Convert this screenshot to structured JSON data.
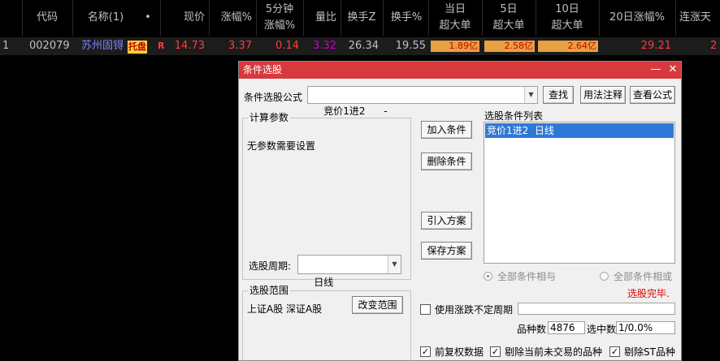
{
  "grid": {
    "headers": {
      "code": "代码",
      "name": "名称(1)",
      "dot": "•",
      "price": "现价",
      "change_pct": "涨幅%",
      "five_min_1": "5分钟",
      "five_min_2": "涨幅%",
      "volume_ratio": "量比",
      "turnover_z": "换手Z",
      "turnover": "换手%",
      "today_1": "当日",
      "today_2": "超大单",
      "d5_1": "5日",
      "d5_2": "超大单",
      "d10_1": "10日",
      "d10_2": "超大单",
      "d20": "20日涨幅%",
      "limit_days": "连涨天"
    },
    "row": {
      "index": "1",
      "code": "002079",
      "name": "苏州固锝",
      "tag": "托盘",
      "flag": "R",
      "price": "14.73",
      "change_pct": "3.37",
      "five_min": "0.14",
      "volume_ratio": "3.32",
      "turnover_z": "26.34",
      "turnover": "19.55",
      "today_big": "1.89亿",
      "d5_big": "2.58亿",
      "d10_big": "2.64亿",
      "d20": "29.21",
      "limit_days": "2"
    }
  },
  "dialog": {
    "title": "条件选股",
    "formula_label": "条件选股公式",
    "formula_value": "竞价1进2      -",
    "buttons": {
      "search": "查找",
      "usage": "用法注释",
      "view_formula": "查看公式",
      "add_condition": "加入条件",
      "delete_condition": "删除条件",
      "import_plan": "引入方案",
      "save_plan": "保存方案",
      "change_range": "改变范围"
    },
    "params_group": "计算参数",
    "params_text": "无参数需要设置",
    "period_label": "选股周期:",
    "period_value": "日线",
    "condition_list_label": "选股条件列表",
    "condition_items": [
      "竞价1进2  日线"
    ],
    "radio_and": "全部条件相与",
    "radio_or": "全部条件相或",
    "status": "选股完毕.",
    "range_group": "选股范围",
    "range_text": "上证A股 深证A股",
    "use_uncertain_period": "使用涨跌不定周期",
    "count_label": "品种数",
    "count_value": "4876",
    "selected_label": "选中数",
    "selected_value": "1/0.0%",
    "opt_adjusted": "前复权数据",
    "opt_remove_untraded": "剔除当前未交易的品种",
    "opt_remove_st": "剔除ST品种"
  },
  "colors": {
    "up_red": "#ff3c3c",
    "purple": "#c800c8",
    "bar_orange": "#e8a040",
    "title_red": "#d8393f",
    "selection_blue": "#3078d6"
  }
}
